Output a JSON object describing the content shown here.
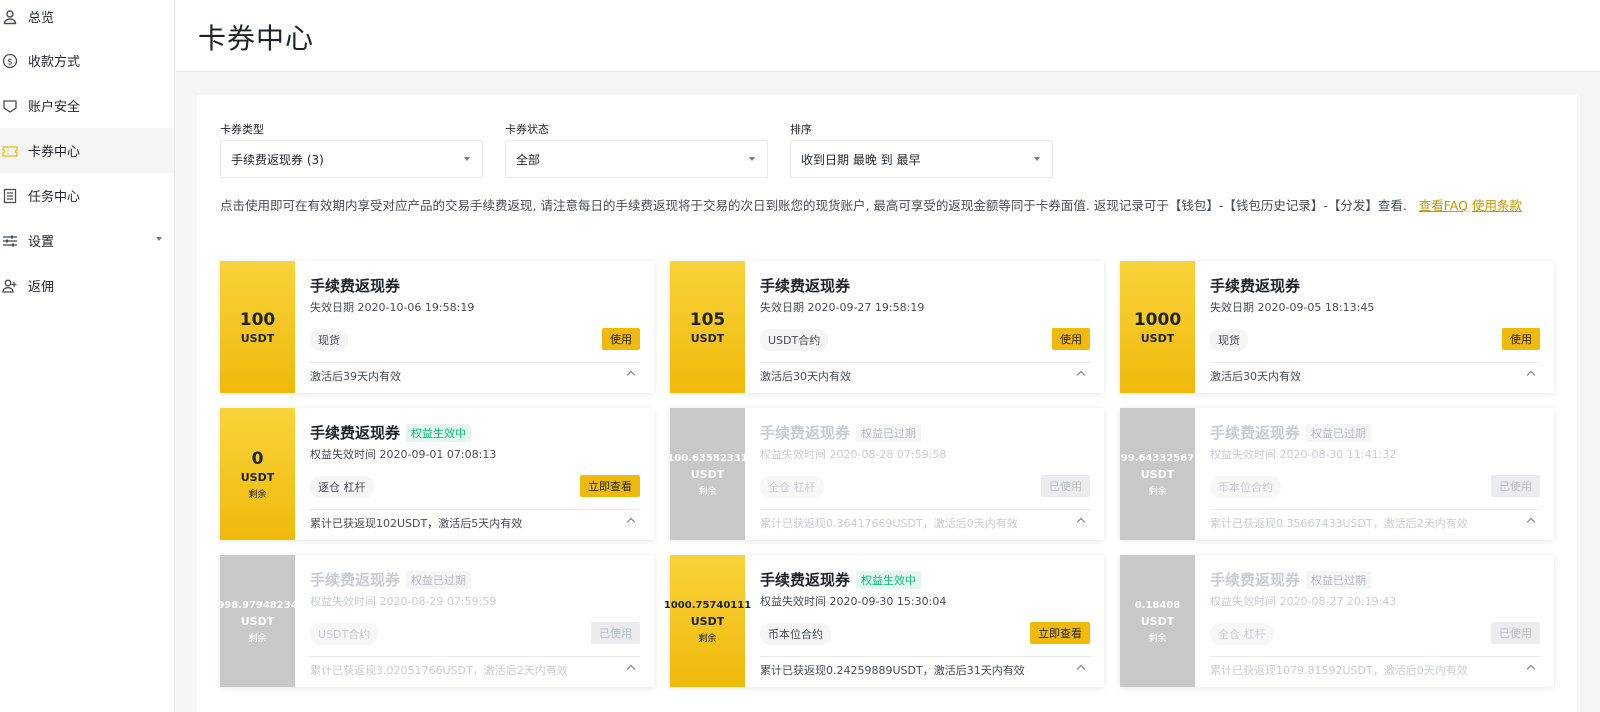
{
  "sidebar": {
    "items": [
      {
        "label": "总览",
        "icon": "user-icon"
      },
      {
        "label": "收款方式",
        "icon": "dollar-icon"
      },
      {
        "label": "账户安全",
        "icon": "shield-icon"
      },
      {
        "label": "卡券中心",
        "icon": "ticket-icon",
        "active": true
      },
      {
        "label": "任务中心",
        "icon": "checklist-icon"
      },
      {
        "label": "设置",
        "icon": "sliders-icon"
      },
      {
        "label": "返佣",
        "icon": "user-plus-icon"
      }
    ]
  },
  "header": {
    "title": "卡券中心"
  },
  "filters": [
    {
      "label": "卡券类型",
      "value": "手续费返现券 (3)"
    },
    {
      "label": "卡券状态",
      "value": "全部"
    },
    {
      "label": "排序",
      "value": "收到日期 最晚 到 最早"
    }
  ],
  "description": {
    "text": "点击使用即可在有效期内享受对应产品的交易手续费返现, 请注意每日的手续费返现将于交易的次日到账您的现货账户, 最高可享受的返现金额等同于卡券面值. 返现记录可于【钱包】-【钱包历史记录】-【分发】查看.",
    "faq_link": "查看FAQ",
    "terms_link": "使用条款"
  },
  "colors": {
    "accent": "#f0b90b",
    "active_green": "#02c076",
    "expired_gray": "#c8c8c8"
  },
  "cards": [
    {
      "amount": "100",
      "unit": "USDT",
      "remaining": "",
      "title": "手续费返现券",
      "badge": "",
      "date": "失效日期 2020-10-06 19:58:19",
      "tag": "现货",
      "button": "使用",
      "footer": "激活后39天内有效"
    },
    {
      "amount": "105",
      "unit": "USDT",
      "remaining": "",
      "title": "手续费返现券",
      "badge": "",
      "date": "失效日期 2020-09-27 19:58:19",
      "tag": "USDT合约",
      "button": "使用",
      "footer": "激活后30天内有效"
    },
    {
      "amount": "1000",
      "unit": "USDT",
      "remaining": "",
      "title": "手续费返现券",
      "badge": "",
      "date": "失效日期 2020-09-05 18:13:45",
      "tag": "现货",
      "button": "使用",
      "footer": "激活后30天内有效"
    },
    {
      "amount": "0",
      "unit": "USDT",
      "remaining": "剩余",
      "title": "手续费返现券",
      "badge": "权益生效中",
      "date": "权益失效时间 2020-09-01 07:08:13",
      "tag": "逐仓 杠杆",
      "button": "立即查看",
      "footer": "累计已获返现102USDT，激活后5天内有效"
    },
    {
      "amount": "100.63582331",
      "unit": "USDT",
      "remaining": "剩余",
      "title": "手续费返现券",
      "badge": "权益已过期",
      "date": "权益失效时间 2020-08-28 07:59:58",
      "tag": "全仓 杠杆",
      "button": "已使用",
      "footer": "累计已获返现0.36417669USDT，激活后0天内有效"
    },
    {
      "amount": "99.64332567",
      "unit": "USDT",
      "remaining": "剩余",
      "title": "手续费返现券",
      "badge": "权益已过期",
      "date": "权益失效时间 2020-08-30 11:41:32",
      "tag": "币本位合约",
      "button": "已使用",
      "footer": "累计已获返现0.35667433USDT，激活后2天内有效"
    },
    {
      "amount": "998.97948234",
      "unit": "USDT",
      "remaining": "剩余",
      "title": "手续费返现券",
      "badge": "权益已过期",
      "date": "权益失效时间 2020-08-29 07:59:59",
      "tag": "USDT合约",
      "button": "已使用",
      "footer": "累计已获返现3.02051766USDT，激活后2天内有效"
    },
    {
      "amount": "1000.75740111",
      "unit": "USDT",
      "remaining": "剩余",
      "title": "手续费返现券",
      "badge": "权益生效中",
      "date": "权益失效时间 2020-09-30 15:30:04",
      "tag": "币本位合约",
      "button": "立即查看",
      "footer": "累计已获返现0.24259889USDT，激活后31天内有效"
    },
    {
      "amount": "0.18408",
      "unit": "USDT",
      "remaining": "剩余",
      "title": "手续费返现券",
      "badge": "权益已过期",
      "date": "权益失效时间 2020-08-27 20:19:43",
      "tag": "全仓 杠杆",
      "button": "已使用",
      "footer": "累计已获返现1079.81592USDT，激活后0天内有效"
    }
  ]
}
